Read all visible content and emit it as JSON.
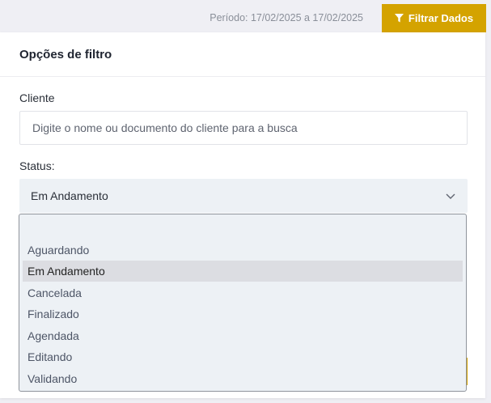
{
  "header": {
    "period_text": "Período: 17/02/2025 a 17/02/2025",
    "filter_button_label": "Filtrar Dados"
  },
  "panel": {
    "title": "Opções de filtro",
    "client": {
      "label": "Cliente",
      "placeholder": "Digite o nome ou documento do cliente para a busca",
      "value": ""
    },
    "status": {
      "label": "Status:",
      "selected": "Em Andamento",
      "options": [
        "",
        "Aguardando",
        "Em Andamento",
        "Cancelada",
        "Finalizado",
        "Agendada",
        "Editando",
        "Validando"
      ],
      "selected_index": 2
    }
  },
  "colors": {
    "accent": "#d4a300",
    "background": "#efeff4",
    "select_bg": "#edf1f5",
    "option_highlight": "#dcdde2"
  },
  "icons": {
    "filter_button": "funnel-icon",
    "select_toggle": "chevron-down-icon"
  }
}
